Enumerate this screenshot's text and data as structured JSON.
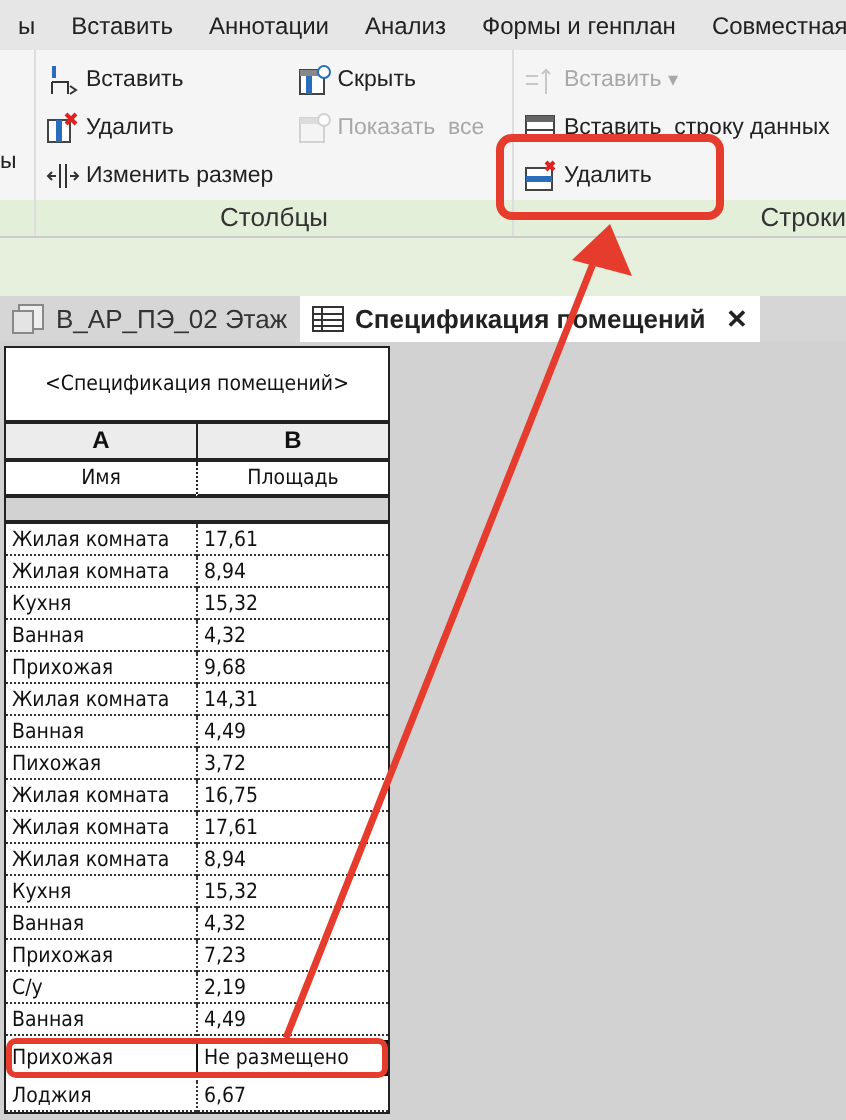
{
  "ribbon_tabs": [
    "ы",
    "Вставить",
    "Аннотации",
    "Анализ",
    "Формы и генплан",
    "Совместная"
  ],
  "left_panel": {
    "fragment": "ы"
  },
  "columns_panel": {
    "label": "Столбцы",
    "items": [
      {
        "kind": "insert-column",
        "label": "Вставить",
        "disabled": false
      },
      {
        "kind": "delete-column",
        "label": "Удалить",
        "disabled": false
      },
      {
        "kind": "resize",
        "label": "Изменить размер",
        "disabled": false
      },
      {
        "kind": "hide",
        "label": "Скрыть",
        "disabled": false
      },
      {
        "kind": "show-all",
        "label": "Показать  все",
        "disabled": true
      }
    ]
  },
  "rows_panel": {
    "label": "Строки",
    "items": [
      {
        "kind": "insert-row",
        "label": "Вставить",
        "disabled": true,
        "dropdown": "▾"
      },
      {
        "kind": "insert-data-row",
        "label": "Вставить  строку данных",
        "disabled": false
      },
      {
        "kind": "delete-row",
        "label": "Удалить",
        "disabled": false
      }
    ]
  },
  "doc_tabs": [
    {
      "label": "В_АР_ПЭ_02 Этаж",
      "selected": false
    },
    {
      "label": "Спецификация помещений",
      "selected": true,
      "close": "✕"
    }
  ],
  "schedule": {
    "title": "<Спецификация помещений>",
    "column_letters": [
      "A",
      "B"
    ],
    "headers": [
      "Имя",
      "Площадь"
    ],
    "rows": [
      {
        "name": "Жилая комната",
        "area": "17,61",
        "selected": false
      },
      {
        "name": "Жилая комната",
        "area": "8,94",
        "selected": false
      },
      {
        "name": "Кухня",
        "area": "15,32",
        "selected": false
      },
      {
        "name": "Ванная",
        "area": "4,32",
        "selected": false
      },
      {
        "name": "Прихожая",
        "area": "9,68",
        "selected": false
      },
      {
        "name": "Жилая комната",
        "area": "14,31",
        "selected": false
      },
      {
        "name": "Ванная",
        "area": "4,49",
        "selected": false
      },
      {
        "name": "Пихожая",
        "area": "3,72",
        "selected": false
      },
      {
        "name": "Жилая комната",
        "area": "16,75",
        "selected": false
      },
      {
        "name": "Жилая комната",
        "area": "17,61",
        "selected": false
      },
      {
        "name": "Жилая комната",
        "area": "8,94",
        "selected": false
      },
      {
        "name": "Кухня",
        "area": "15,32",
        "selected": false
      },
      {
        "name": "Ванная",
        "area": "4,32",
        "selected": false
      },
      {
        "name": "Прихожая",
        "area": "7,23",
        "selected": false
      },
      {
        "name": "С/у",
        "area": "2,19",
        "selected": false
      },
      {
        "name": "Ванная",
        "area": "4,49",
        "selected": false
      },
      {
        "name": "Прихожая",
        "area": "Не размещено",
        "selected": true
      },
      {
        "name": "Лоджия",
        "area": "6,67",
        "selected": false
      }
    ]
  }
}
